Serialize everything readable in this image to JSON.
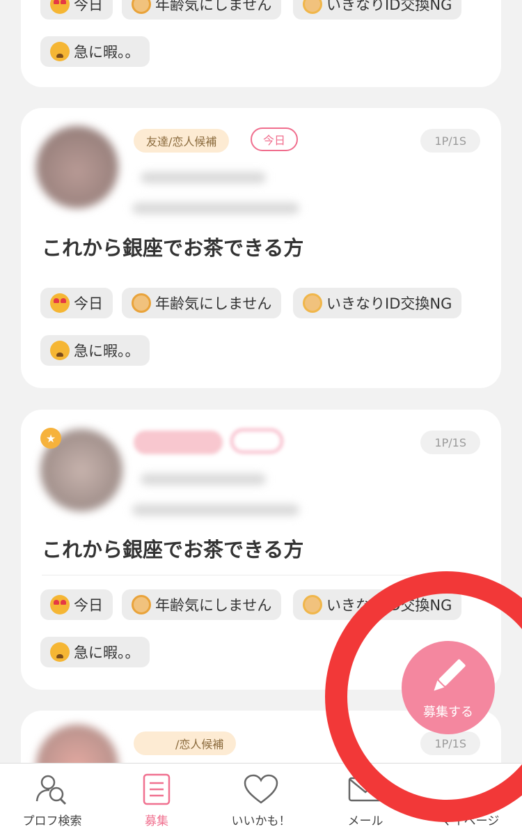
{
  "tags": {
    "today": "今日",
    "age": "年齢気にしません",
    "id": "いきなりID交換NG",
    "bored": "急に暇。。"
  },
  "posts": [
    {
      "title": "これから銀座でお茶できる方",
      "type_badge": "友達/恋人候補",
      "today_badge": "今日",
      "count": "1P/1S"
    },
    {
      "title": "これから銀座でお茶できる方",
      "count": "1P/1S"
    },
    {
      "type_badge": "/恋人候補",
      "count": "1P/1S"
    }
  ],
  "fab": {
    "label": "募集する"
  },
  "tabbar": {
    "items": [
      {
        "label": "プロフ検索",
        "icon": "profile-search-icon"
      },
      {
        "label": "募集",
        "icon": "list-document-icon",
        "active": true
      },
      {
        "label": "いいかも！",
        "icon": "heart-icon"
      },
      {
        "label": "メール",
        "icon": "mail-icon"
      },
      {
        "label": "マイページ",
        "icon": "my-page-icon"
      }
    ]
  },
  "colors": {
    "accent": "#f0708f",
    "annotation": "#f23838",
    "badge_type_bg": "#fdebd3"
  }
}
